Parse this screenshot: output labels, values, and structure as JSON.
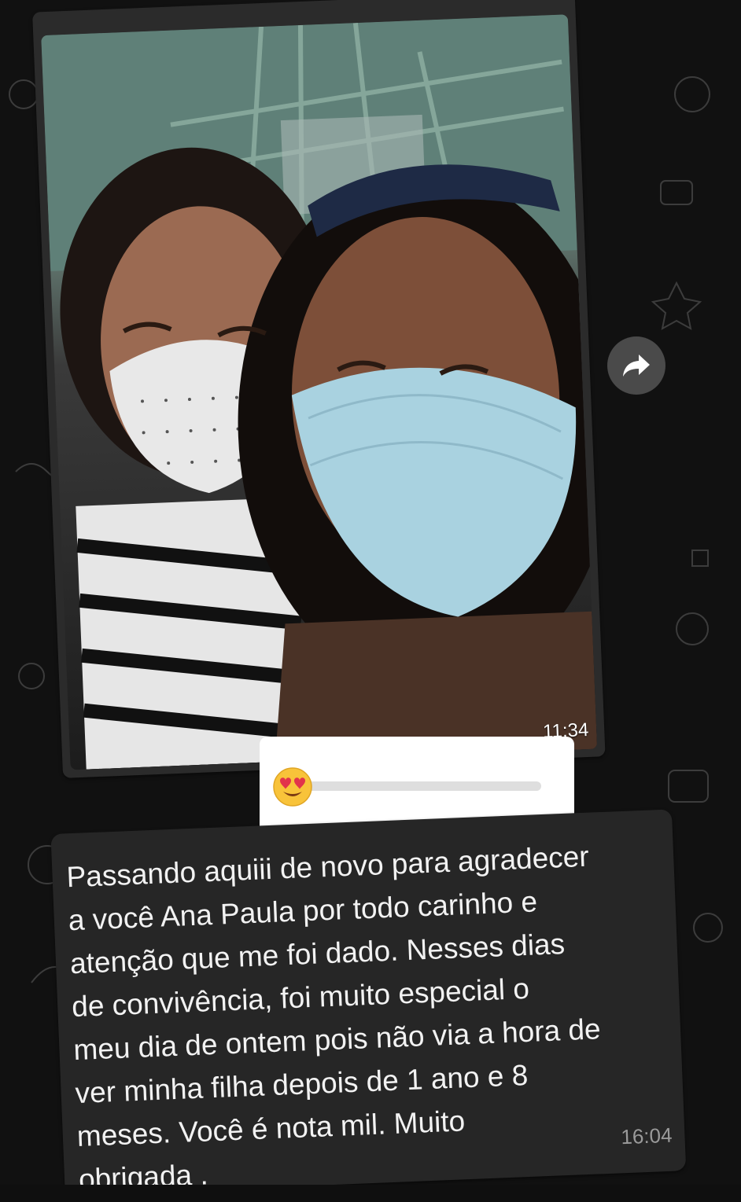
{
  "chat": {
    "image_message": {
      "time": "11:34",
      "photo_description_icon": "photo-icon"
    },
    "forward_icon": "forward-arrow-icon",
    "reaction": {
      "emoji_icon": "heart-eyes-emoji-icon",
      "slider_level": 0.0
    },
    "text_message": {
      "text": "Passando aquiii de novo para  agradecer\na você Ana Paula por todo carinho  e\natenção  que  me foi dado.  Nesses  dias\nde  convivência, foi  muito  especial o\nmeu dia de ontem pois não via a hora de\nver minha filha depois de 1 ano e 8\nmeses. Você  é  nota mil. Muito\nobrigada .",
      "time": "16:04"
    }
  },
  "colors": {
    "background": "#111111",
    "bubble": "#262626",
    "text": "#f2f2f2",
    "time": "#9a9a9a"
  }
}
